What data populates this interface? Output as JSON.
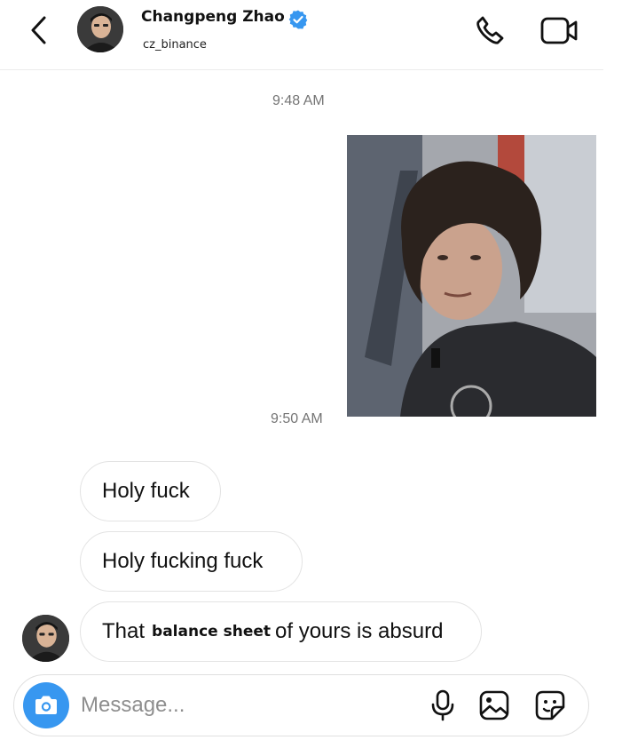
{
  "header": {
    "name": "Changpeng Zhao",
    "handle": "cz_binance",
    "icons": {
      "back": "chevron-left-icon",
      "verified": "verified-badge-icon",
      "call": "phone-icon",
      "video": "video-camera-icon"
    },
    "colors": {
      "verified": "#3797f0"
    }
  },
  "thread": {
    "timestamp_1": "9:48 AM",
    "timestamp_2": "9:50 AM",
    "messages": [
      {
        "text": "Holy fuck"
      },
      {
        "text": "Holy fucking fuck"
      },
      {
        "prefix": "That",
        "bold": "balance sheet",
        "suffix": "of yours is absurd"
      }
    ]
  },
  "composer": {
    "placeholder": "Message...",
    "value": "",
    "icons": {
      "camera": "camera-icon",
      "mic": "microphone-icon",
      "gallery": "image-icon",
      "sticker": "sticker-icon"
    },
    "colors": {
      "camera": "#3797f0"
    }
  }
}
